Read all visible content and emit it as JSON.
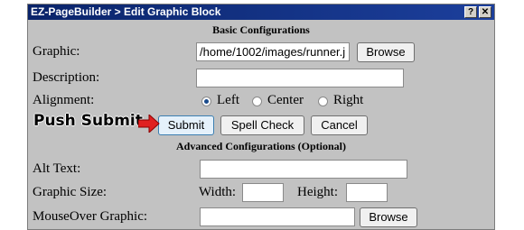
{
  "window": {
    "title": "EZ-PageBuilder > Edit Graphic Block",
    "help_label": "?",
    "close_label": "✕"
  },
  "basic": {
    "heading": "Basic Configurations",
    "graphic_label": "Graphic:",
    "graphic_value": "/home/1002/images/runner.j",
    "browse_label": "Browse",
    "description_label": "Description:",
    "description_value": "",
    "alignment_label": "Alignment:",
    "alignment_options": [
      "Left",
      "Center",
      "Right"
    ],
    "alignment_selected": "Left"
  },
  "buttons": {
    "submit": "Submit",
    "spell_check": "Spell Check",
    "cancel": "Cancel"
  },
  "annotation": {
    "text": "Push Submit",
    "arrow_color": "#e02020"
  },
  "advanced": {
    "heading": "Advanced Configurations (Optional)",
    "alt_text_label": "Alt Text:",
    "alt_text_value": "",
    "size_label": "Graphic Size:",
    "width_label": "Width:",
    "width_value": "",
    "height_label": "Height:",
    "height_value": "",
    "mouseover_label": "MouseOver Graphic:",
    "mouseover_value": "",
    "browse_label": "Browse"
  }
}
